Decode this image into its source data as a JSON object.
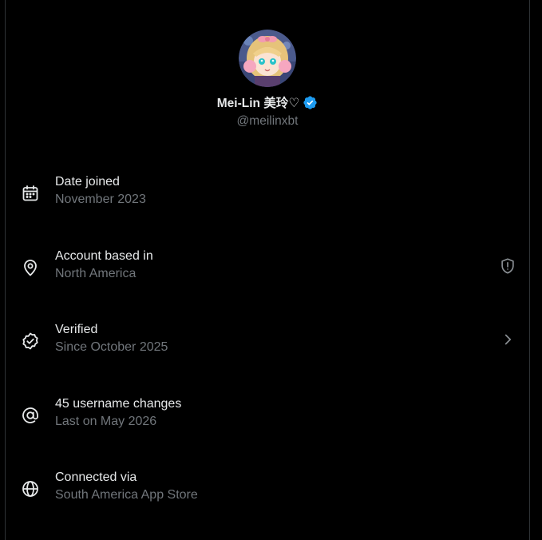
{
  "profile": {
    "display_name": "Mei-Lin 美玲♡",
    "handle": "@meilinxbt",
    "verified": true,
    "verified_color": "#1d9bf0"
  },
  "colors": {
    "background": "#000000",
    "primary_text": "#e7e9ea",
    "secondary_text": "#71767b",
    "border": "#2f3336"
  },
  "rows": [
    {
      "icon": "calendar-icon",
      "title": "Date joined",
      "subtitle": "November 2023"
    },
    {
      "icon": "location-pin-icon",
      "title": "Account based in",
      "subtitle": "North America",
      "trailing_icon": "shield-alert-icon"
    },
    {
      "icon": "verified-badge-icon",
      "title": "Verified",
      "subtitle": "Since October 2025",
      "trailing_icon": "chevron-right-icon"
    },
    {
      "icon": "at-sign-icon",
      "title": "45 username changes",
      "subtitle": "Last on May 2026"
    },
    {
      "icon": "globe-icon",
      "title": "Connected via",
      "subtitle": "South America App Store"
    }
  ]
}
